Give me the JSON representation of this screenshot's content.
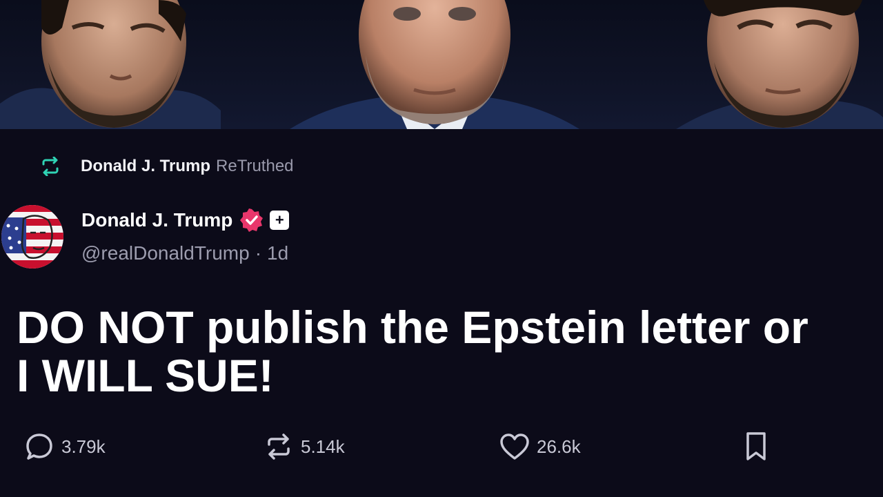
{
  "banner": {
    "portraits": [
      "portrait-left",
      "portrait-center",
      "portrait-right"
    ]
  },
  "retruth": {
    "icon": "retruth-icon",
    "name": "Donald J. Trump",
    "label": "ReTruthed",
    "accent": "#2fd3b4"
  },
  "author": {
    "name": "Donald J. Trump",
    "handle": "@realDonaldTrump",
    "separator": "·",
    "time": "1d",
    "verified_icon": "verified-badge-icon",
    "verified_color": "#e8366b",
    "plus_badge": "+"
  },
  "post": {
    "text_line1": "DO NOT publish the Epstein letter or",
    "text_line2": "I WILL SUE!"
  },
  "actions": {
    "reply": {
      "icon": "reply-icon",
      "count": "3.79k"
    },
    "retruth": {
      "icon": "retruth-icon",
      "count": "5.14k"
    },
    "like": {
      "icon": "heart-icon",
      "count": "26.6k"
    },
    "bookmark": {
      "icon": "bookmark-icon"
    }
  },
  "colors": {
    "background": "#0c0b19",
    "text": "#ffffff",
    "muted": "#9c9cae"
  }
}
